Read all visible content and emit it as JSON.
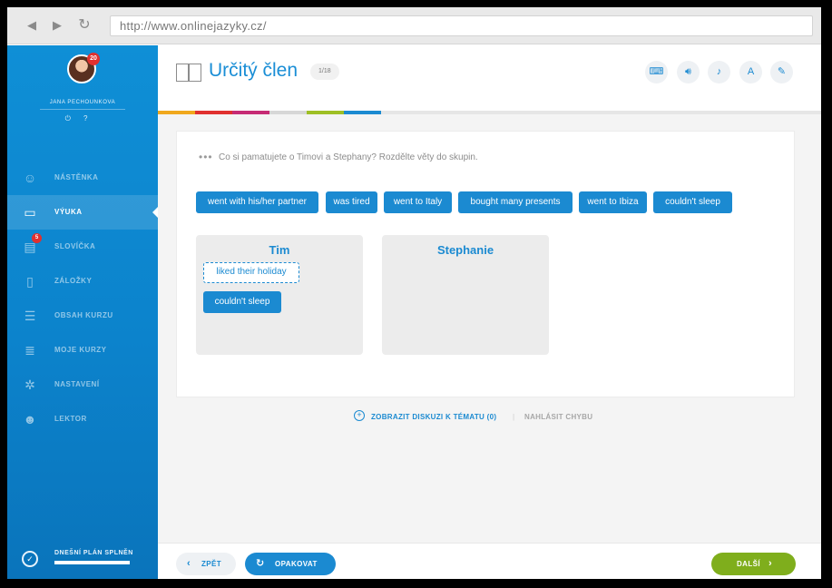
{
  "browser": {
    "url": "http://www.onlinejazyky.cz/"
  },
  "user": {
    "name": "JANA PECHOUNKOVA",
    "notifications": "20"
  },
  "sidebar": {
    "items": [
      {
        "id": "nastenka",
        "label": "NÁSTĚNKA",
        "icon": "dashboard-icon"
      },
      {
        "id": "vyuka",
        "label": "VÝUKA",
        "icon": "book-icon",
        "active": true
      },
      {
        "id": "slovicka",
        "label": "SLOVÍČKA",
        "icon": "vocabulary-icon",
        "badge": "5"
      },
      {
        "id": "zalozky",
        "label": "ZÁLOŽKY",
        "icon": "bookmark-icon"
      },
      {
        "id": "obsah",
        "label": "OBSAH KURZU",
        "icon": "contents-icon"
      },
      {
        "id": "kurzy",
        "label": "MOJE KURZY",
        "icon": "courses-icon"
      },
      {
        "id": "nastaveni",
        "label": "NASTAVENÍ",
        "icon": "gear-icon"
      },
      {
        "id": "lektor",
        "label": "LEKTOR",
        "icon": "user-icon"
      }
    ],
    "plan": {
      "label": "DNEŠNÍ PLÁN SPLNĚN",
      "progress": 1
    }
  },
  "header": {
    "title": "Určitý člen",
    "counter": "1/18"
  },
  "colors": {
    "accent": "#1b8ad1",
    "next": "#7fae1c",
    "progress_segments": [
      "#f0a81d",
      "#e0312f",
      "#c62b74",
      "#9ebf25",
      "#1b8ad1"
    ]
  },
  "exercise": {
    "instruction": "Co si pamatujete o Timovi a Stephany? Rozdělte věty do skupin.",
    "chips": [
      "went with his/her partner",
      "was tired",
      "went to Italy",
      "bought many presents",
      "went to Ibiza",
      "couldn't sleep"
    ],
    "groups": [
      {
        "title": "Tim",
        "placeholder": "liked their holiday",
        "items": [
          "couldn't sleep"
        ]
      },
      {
        "title": "Stephanie",
        "items": []
      }
    ]
  },
  "links": {
    "discuss": "ZOBRAZIT DISKUZI K TÉMATU (0)",
    "separator": "|",
    "report": "NAHLÁSIT CHYBU"
  },
  "footer": {
    "back": "ZPĚT",
    "repeat": "OPAKOVAT",
    "next": "DALŠÍ"
  }
}
